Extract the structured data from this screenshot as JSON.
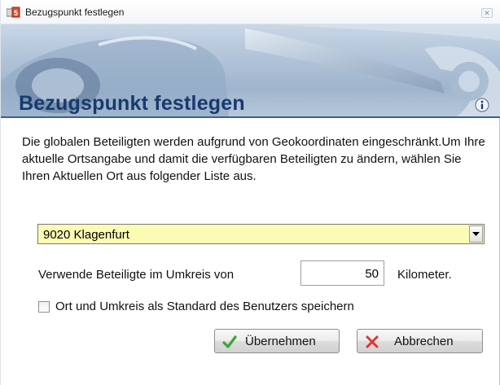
{
  "window": {
    "title": "Bezugspunkt festlegen",
    "close_symbol": "✕"
  },
  "banner": {
    "heading": "Bezugspunkt festlegen",
    "info_icon": "info-icon"
  },
  "description": "Die globalen Beteiligten werden aufgrund von Geokoordinaten eingeschränkt.Um Ihre aktuelle Ortsangabe und damit die verfügbaren Beteiligten zu ändern, wählen Sie Ihren Aktuellen Ort aus folgender Liste aus.",
  "location_select": {
    "selected": "9020 Klagenfurt",
    "background_color": "#fbfbb4"
  },
  "radius": {
    "label": "Verwende Beteiligte im Umkreis von",
    "value": "50",
    "unit": "Kilometer."
  },
  "save_default": {
    "label": "Ort und Umkreis als Standard des Benutzers speichern",
    "checked": false
  },
  "buttons": {
    "ok_label": "Übernehmen",
    "ok_icon": "checkmark-icon",
    "cancel_label": "Abbrechen",
    "cancel_icon": "cross-icon"
  },
  "colors": {
    "heading": "#173a6e",
    "rule": "#3b5f96",
    "ok_icon": "#3fa33a",
    "cancel_icon": "#e03535"
  }
}
